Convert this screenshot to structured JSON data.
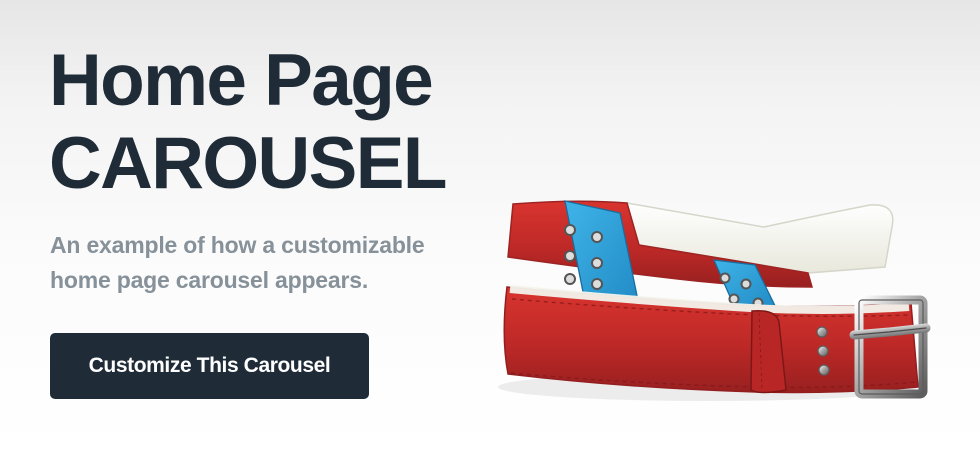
{
  "hero": {
    "title_line_1": "Home Page",
    "title_line_2": "CAROUSEL",
    "description_line_1": "An example of how a customizable",
    "description_line_2": "home page carousel appears.",
    "button_label": "Customize This Carousel"
  },
  "product": {
    "image_subject": "red and blue leather belt with silver buckle"
  },
  "colors": {
    "title": "#1f2c38",
    "description": "#86919a",
    "button_background": "#1f2c38",
    "button_text": "#ffffff",
    "belt_red": "#c62d2a",
    "belt_blue": "#2b9ed5",
    "belt_white": "#f4f4ec"
  }
}
